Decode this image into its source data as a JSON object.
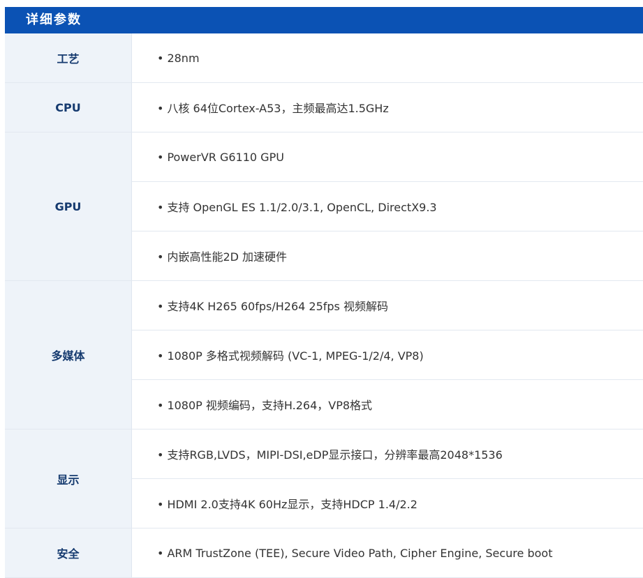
{
  "header": {
    "title": "详细参数"
  },
  "specs": [
    {
      "label": "工艺",
      "values": [
        "28nm"
      ]
    },
    {
      "label": "CPU",
      "values": [
        "八核 64位Cortex-A53，主频最高达1.5GHz"
      ]
    },
    {
      "label": "GPU",
      "values": [
        "PowerVR G6110 GPU",
        "支持 OpenGL ES 1.1/2.0/3.1, OpenCL, DirectX9.3",
        "内嵌高性能2D 加速硬件"
      ]
    },
    {
      "label": "多媒体",
      "values": [
        "支持4K H265 60fps/H264 25fps 视频解码",
        "1080P 多格式视频解码 (VC-1, MPEG-1/2/4, VP8)",
        "1080P 视频编码，支持H.264，VP8格式"
      ]
    },
    {
      "label": "显示",
      "values": [
        "支持RGB,LVDS，MIPI-DSI,eDP显示接口，分辨率最高2048*1536",
        "HDMI 2.0支持4K 60Hz显示，支持HDCP 1.4/2.2"
      ]
    },
    {
      "label": "安全",
      "values": [
        "ARM TrustZone (TEE), Secure Video Path, Cipher Engine, Secure boot"
      ]
    }
  ],
  "bullet": "•",
  "colors": {
    "header_bg": "#0b52b4",
    "label_bg": "#eef3f9",
    "label_text": "#153a6f",
    "value_text": "#333333"
  }
}
